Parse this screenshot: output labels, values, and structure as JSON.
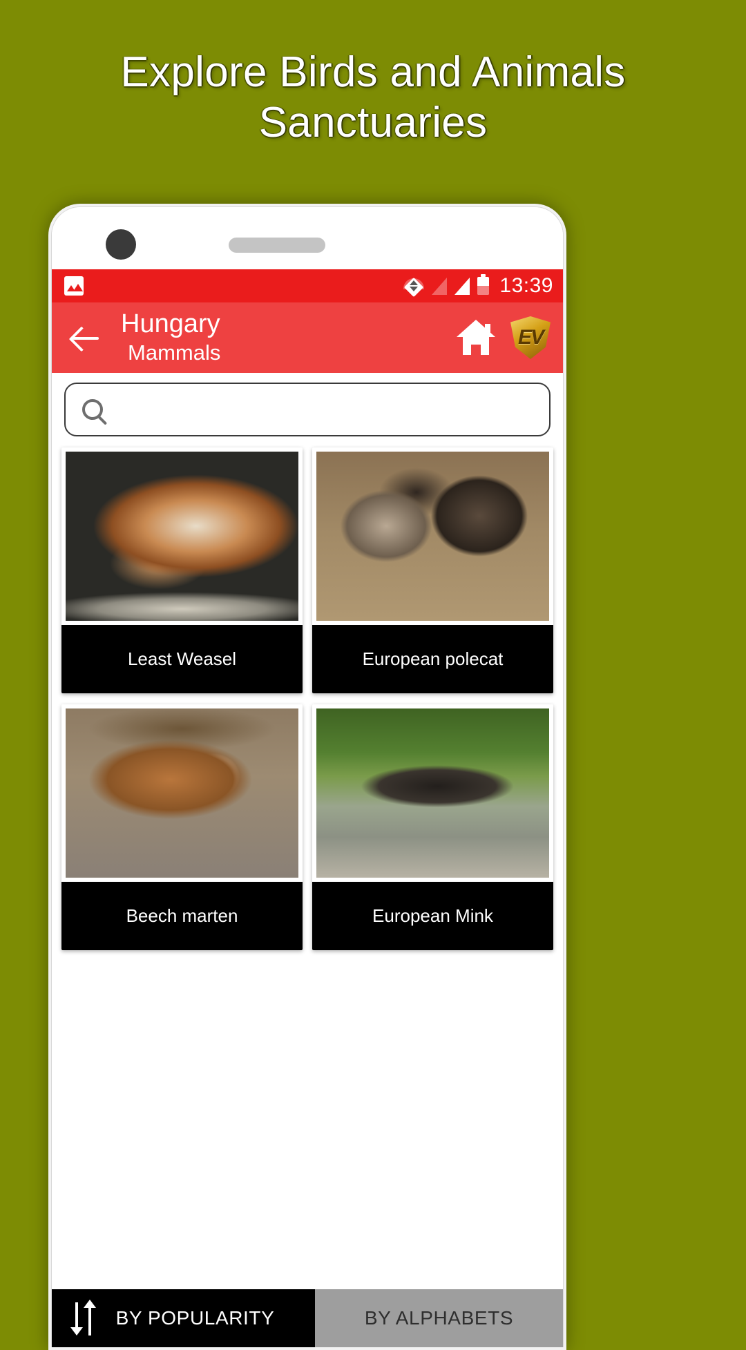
{
  "promo": {
    "headline_line1": "Explore Birds and Animals",
    "headline_line2": "Sanctuaries",
    "background_color": "#7d8c04"
  },
  "status_bar": {
    "photo_icon": "photo-icon",
    "wifi_icon": "wifi-icon",
    "signal_icon_1": "signal-bars-empty-icon",
    "signal_icon_2": "signal-bars-full-icon",
    "battery_icon": "battery-icon",
    "time": "13:39",
    "background_color": "#ea1c1c"
  },
  "toolbar": {
    "back_icon": "back-arrow-icon",
    "title": "Hungary",
    "subtitle": "Mammals",
    "home_icon": "home-icon",
    "logo_text": "EV",
    "logo_icon": "shield-logo-icon",
    "background_color": "#ee4141"
  },
  "search": {
    "icon": "search-icon",
    "value": "",
    "placeholder": ""
  },
  "grid": {
    "cards": [
      {
        "label": "Least Weasel",
        "image": "img-weasel"
      },
      {
        "label": "European polecat",
        "image": "img-polecat"
      },
      {
        "label": "Beech marten",
        "image": "img-marten"
      },
      {
        "label": "European Mink",
        "image": "img-mink"
      }
    ]
  },
  "sort_bar": {
    "sort_icon": "sort-arrows-icon",
    "popularity_label": "BY POPULARITY",
    "alphabets_label": "BY ALPHABETS",
    "active": "BY POPULARITY",
    "active_color": "#000000",
    "inactive_color": "#9e9e9e"
  }
}
